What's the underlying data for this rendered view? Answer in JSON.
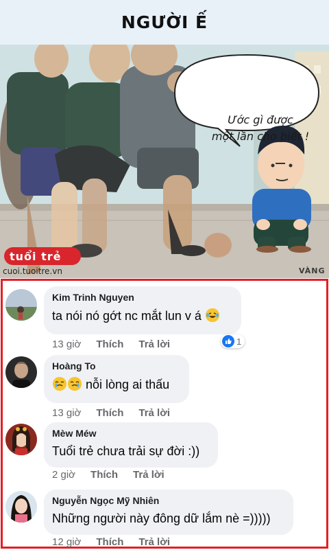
{
  "header": {
    "title": "NGƯỜI Ế"
  },
  "comic": {
    "speech_lines": [
      "Ước gì được",
      "một lần cho biết !"
    ],
    "logo_text": "tuổi trẻ",
    "logo_url": "cuoi.tuoitre.vn",
    "artist": "VÀNG"
  },
  "comments": [
    {
      "author": "Kim Trinh Nguyen",
      "text": "ta nói nó gớt nc mắt lun v á",
      "emoji": "laughing-tears-emoji",
      "time": "13 giờ",
      "like_label": "Thích",
      "reply_label": "Trả lời",
      "reaction_count": "1"
    },
    {
      "author": "Hoàng To",
      "text": "nỗi lòng ai thấu",
      "emoji": "crying-laughing-emoji",
      "time": "13 giờ",
      "like_label": "Thích",
      "reply_label": "Trả lời"
    },
    {
      "author": "Mèw Méw",
      "text": "Tuổi trẻ chưa trải sự đời :))",
      "time": "2 giờ",
      "like_label": "Thích",
      "reply_label": "Trả lời"
    },
    {
      "author": "Nguyễn Ngọc Mỹ Nhiên",
      "text": "Những người này đông dữ lắm nè =)))))",
      "time": "12 giờ",
      "like_label": "Thích",
      "reply_label": "Trả lời"
    }
  ],
  "colors": {
    "highlight_border": "#e01f26",
    "bubble_bg": "#eff1f4",
    "like_blue": "#1877f2",
    "header_bg": "#e8f0f8"
  }
}
